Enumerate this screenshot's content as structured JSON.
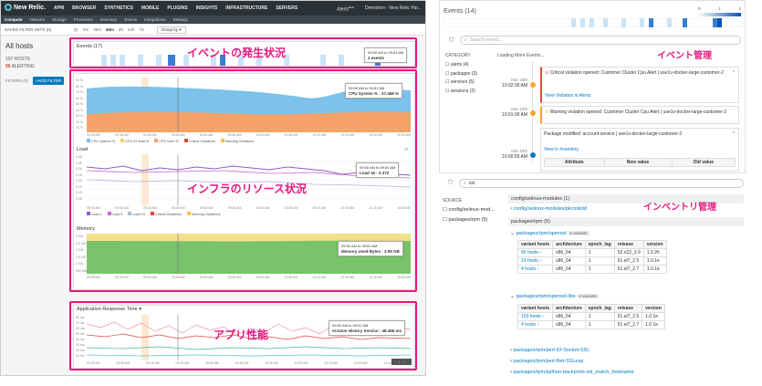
{
  "app": {
    "logo": "New Relic.",
    "nav": [
      "APM",
      "BROWSER",
      "SYNTHETICS",
      "MOBILE",
      "PLUGINS",
      "INSIGHTS",
      "INFRASTRUCTURE",
      "SERVERS"
    ],
    "alerts": "Alerts",
    "alerts_badge": "New",
    "account": "Demotron - New Relic Par...",
    "subnav": [
      "Compute",
      "Network",
      "Storage",
      "Processes",
      "Inventory",
      "Events",
      "Integrations",
      "Settings"
    ],
    "saved_filter": "SAVED FILTER SETS (0)",
    "time_options": [
      "5m",
      "30m",
      "60m",
      "6h",
      "24h",
      "7d"
    ],
    "time_selected": "60m",
    "group_by": "Group by",
    "sidebar_title": "All hosts",
    "hosts_count": "107 HOSTS",
    "alerting_count": "96",
    "alerting_label": "ALERTING",
    "filters_label": "FILTERS (0)",
    "add_filter": "ADD FILTER"
  },
  "events_panel": {
    "title": "Events (17)",
    "tooltip_time": "09:50 AM to 09:51 AM",
    "tooltip_value": "2 events",
    "jp_label": "イベントの発生状況"
  },
  "cpu_panel": {
    "tooltip_time": "09:50 AM to 09:51 AM",
    "tooltip_value": "CPU System % : 37.468 %",
    "legend": [
      "CPU System %",
      "CPU IO Wait %",
      "CPU User %",
      "Critical Violations",
      "Warning Violations"
    ],
    "y_ticks": [
      "90 %",
      "80 %",
      "70 %",
      "60 %",
      "50 %",
      "40 %",
      "30 %",
      "20 %",
      "10 %"
    ]
  },
  "load_panel": {
    "title": "Load",
    "tooltip_time": "09:50 AM to 09:51 AM",
    "tooltip_value": "Load 15 : 0.372",
    "legend": [
      "Load 1",
      "Load 5",
      "Load 15",
      "Critical Violations",
      "Warning Violations"
    ],
    "y_ticks": [
      "0.40",
      "0.35",
      "0.30",
      "0.25",
      "0.20",
      "0.15",
      "0.10",
      "0.05"
    ],
    "jp_label": "インフラのリソース状況"
  },
  "memory_panel": {
    "title": "Memory",
    "tooltip_time": "09:50 AM to 09:51 AM",
    "tooltip_value": "Memory Used Bytes : 3.09 GB",
    "y_ticks": [
      "3 GB",
      "2.5 GB",
      "2 GB",
      "1.5 GB",
      "1 GB",
      "500 MB"
    ]
  },
  "app_panel": {
    "title": "Application Response Time",
    "tooltip_time": "09:50 AM to 09:51 AM",
    "tooltip_value": "eComm History Service : 48.456 ms",
    "y_ticks": [
      "80 ms",
      "70 ms",
      "60 ms",
      "50 ms",
      "40 ms",
      "30 ms",
      "20 ms",
      "10 ms"
    ],
    "jp_label": "アプリ性能"
  },
  "x_ticks": [
    "09:30 AM",
    "09:35 AM",
    "09:40 AM",
    "09:45 AM",
    "09:50 AM",
    "09:55 AM",
    "10:00 AM",
    "10:05 AM",
    "10:10 AM",
    "10:15 AM",
    "10:20 AM",
    "10:25 AM"
  ],
  "right_events": {
    "title": "Events (14)",
    "search_placeholder": "Search events...",
    "loading": "Loading More Events...",
    "jp_label": "イベント管理",
    "scale": [
      "0",
      "1",
      "2"
    ],
    "category_label": "CATEGORY",
    "categories": [
      "alerts (4)",
      "packages (3)",
      "services (5)",
      "sessions (2)"
    ],
    "e1_date": "Mar 10th",
    "e1_time": "10:02:00 AM",
    "e1_text": "Critical violation opened: Customer Cluster Cpu Alert",
    "e1_host": "use1v-docker-large-customer-2",
    "e1_link": "View Violation in Alerts",
    "e2_date": "Mar 10th",
    "e2_time": "10:01:00 AM",
    "e2_text": "Warning violation opened: Customer Cluster Cpu Alert",
    "e2_host": "use1v-docker-large-customer-2",
    "e3_date": "Mar 10th",
    "e3_time": "10:00:55 AM",
    "e3_text": "Package modified: account-service",
    "e3_host": "use1v-docker-large-customer-2",
    "e3_link": "View in Inventory",
    "cols": [
      "Attribute",
      "New value",
      "Old value"
    ]
  },
  "right_inventory": {
    "search_value": "ssl",
    "jp_label": "インベントリ管理",
    "source_label": "SOURCE",
    "sources": [
      "config/selinux-mod...",
      "packages/rpm (5)"
    ],
    "config_group": "config/selinux-modules (1)",
    "config_item": "config/selinux-modules/pkcsslotd",
    "rpm_group": "packages/rpm (5)",
    "openssl": {
      "name": "packages/rpm/openssl",
      "variants": "3 variants",
      "cols": [
        "variant hosts",
        "architecture",
        "epoch_tag",
        "release",
        "version"
      ],
      "rows": [
        [
          "90 hosts",
          "x86_64",
          "1",
          "52.n22_3.9",
          "1.0.2h"
        ],
        [
          "13 hosts",
          "x86_64",
          "1",
          "51.el7_2.5",
          "1.0.1e"
        ],
        [
          "4 hosts",
          "x86_64",
          "1",
          "51.el7_2.7",
          "1.0.1e"
        ]
      ]
    },
    "openssl_libs": {
      "name": "packages/rpm/openssl-libs",
      "variants": "2 variants",
      "cols": [
        "variant hosts",
        "architecture",
        "epoch_tag",
        "release",
        "version"
      ],
      "rows": [
        [
          "103 hosts",
          "x86_64",
          "1",
          "51.el7_2.5",
          "1.0.1e"
        ],
        [
          "4 hosts",
          "x86_64",
          "1",
          "51.el7_2.7",
          "1.0.1e"
        ]
      ]
    },
    "more": [
      "packages/rpm/perl-IO-Socket-SSL",
      "packages/rpm/perl-Net-SSLeay",
      "packages/rpm/python-backports-ssl_match_hostname"
    ]
  },
  "colors": {
    "pink": "#e5177e",
    "blue": "#0079bf",
    "cpu_blue": "#7cc2ea",
    "cpu_orange": "#f5a26b",
    "mem_green": "#79c36a",
    "mem_yellow": "#f2e08a"
  }
}
